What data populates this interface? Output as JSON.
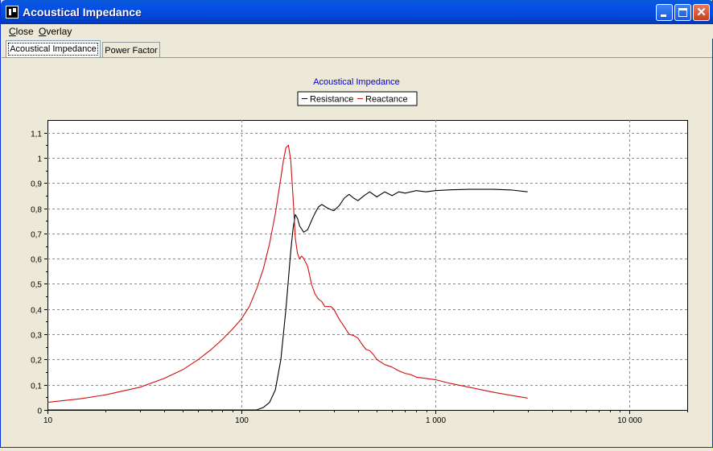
{
  "window": {
    "title": "Acoustical Impedance"
  },
  "menu": [
    {
      "underline": "C",
      "rest": "lose"
    },
    {
      "underline": "O",
      "rest": "verlay"
    }
  ],
  "tabs": [
    {
      "label": "Acoustical Impedance",
      "active": true
    },
    {
      "label": "Power Factor",
      "active": false
    }
  ],
  "colors": {
    "resistance": "#000000",
    "reactance": "#d01010",
    "title": "#0000cc"
  },
  "chart_data": {
    "type": "line",
    "title": "Acoustical Impedance",
    "xlabel": "",
    "ylabel": "",
    "xscale": "log",
    "xlim": [
      10,
      20000
    ],
    "ylim": [
      0,
      1.15
    ],
    "grid": true,
    "legend_position": "top-center",
    "x_ticks": [
      10,
      100,
      1000,
      10000
    ],
    "x_tick_labels": [
      "10",
      "100",
      "1 000",
      "10 000"
    ],
    "y_ticks": [
      0,
      0.1,
      0.2,
      0.3,
      0.4,
      0.5,
      0.6,
      0.7,
      0.8,
      0.9,
      1,
      1.1
    ],
    "y_tick_labels": [
      "0",
      "0,1",
      "0,2",
      "0,3",
      "0,4",
      "0,5",
      "0,6",
      "0,7",
      "0,8",
      "0,9",
      "1",
      "1,1"
    ],
    "series": [
      {
        "name": "Resistance",
        "x": [
          10,
          100,
          120,
          130,
          140,
          150,
          160,
          170,
          180,
          185,
          190,
          195,
          200,
          210,
          220,
          230,
          240,
          250,
          260,
          280,
          300,
          320,
          340,
          360,
          380,
          400,
          430,
          460,
          500,
          550,
          600,
          650,
          700,
          800,
          900,
          1000,
          1200,
          1500,
          2000,
          2500,
          3000
        ],
        "y": [
          0,
          0,
          0,
          0.01,
          0.03,
          0.08,
          0.2,
          0.4,
          0.63,
          0.72,
          0.775,
          0.76,
          0.73,
          0.705,
          0.715,
          0.75,
          0.78,
          0.805,
          0.815,
          0.8,
          0.79,
          0.81,
          0.84,
          0.855,
          0.84,
          0.83,
          0.85,
          0.865,
          0.845,
          0.865,
          0.85,
          0.865,
          0.86,
          0.87,
          0.865,
          0.87,
          0.873,
          0.875,
          0.875,
          0.872,
          0.865
        ]
      },
      {
        "name": "Reactance",
        "x": [
          10,
          15,
          20,
          30,
          40,
          50,
          60,
          70,
          80,
          90,
          100,
          110,
          120,
          130,
          140,
          150,
          160,
          165,
          170,
          175,
          180,
          185,
          190,
          195,
          200,
          205,
          210,
          220,
          230,
          240,
          250,
          260,
          270,
          280,
          290,
          300,
          320,
          340,
          360,
          380,
          400,
          420,
          440,
          460,
          480,
          500,
          550,
          600,
          650,
          700,
          750,
          800,
          900,
          1000,
          1200,
          1500,
          2000,
          2500,
          3000
        ],
        "y": [
          0.03,
          0.045,
          0.06,
          0.09,
          0.125,
          0.16,
          0.2,
          0.24,
          0.28,
          0.32,
          0.36,
          0.41,
          0.48,
          0.56,
          0.66,
          0.78,
          0.92,
          0.99,
          1.04,
          1.05,
          0.99,
          0.84,
          0.68,
          0.62,
          0.6,
          0.61,
          0.6,
          0.57,
          0.5,
          0.46,
          0.44,
          0.43,
          0.41,
          0.41,
          0.41,
          0.4,
          0.36,
          0.33,
          0.3,
          0.295,
          0.285,
          0.26,
          0.24,
          0.235,
          0.22,
          0.2,
          0.18,
          0.17,
          0.155,
          0.145,
          0.14,
          0.13,
          0.125,
          0.12,
          0.105,
          0.09,
          0.07,
          0.057,
          0.047
        ]
      }
    ]
  }
}
